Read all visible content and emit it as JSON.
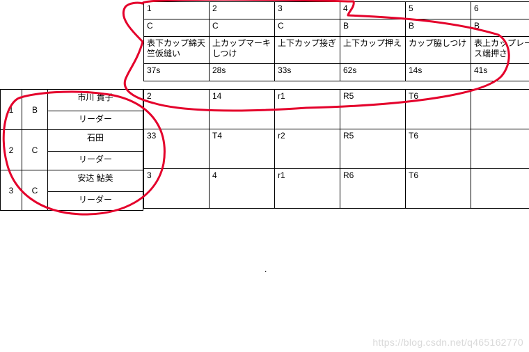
{
  "top": {
    "cols": [
      "1",
      "2",
      "3",
      "4",
      "5",
      "6"
    ],
    "grades": [
      "C",
      "C",
      "C",
      "B",
      "B",
      "B"
    ],
    "desc": [
      "表下カップ綿天竺仮縫い",
      "上カップマーキしつけ",
      "上下カップ接ぎ",
      "上下カップ押え",
      "カップ脇しつけ",
      "表上カップレース端押さ"
    ],
    "times": [
      "37s",
      "28s",
      "33s",
      "62s",
      "14s",
      "41s"
    ]
  },
  "people": [
    {
      "idx": "1",
      "grade": "B",
      "name": "市川 貴子",
      "role": "リーダー"
    },
    {
      "idx": "2",
      "grade": "C",
      "name": "石田",
      "role": "リーダー"
    },
    {
      "idx": "3",
      "grade": "C",
      "name": "安达 鮎美",
      "role": "リーダー"
    }
  ],
  "grid": [
    [
      "2",
      "14",
      "r1",
      "R5",
      "T6",
      ""
    ],
    [
      "33",
      "T4",
      "r2",
      "R5",
      "T6",
      ""
    ],
    [
      "3",
      "4",
      "r1",
      "R6",
      "T6",
      ""
    ]
  ],
  "watermark": "https://blog.csdn.net/q465162770"
}
